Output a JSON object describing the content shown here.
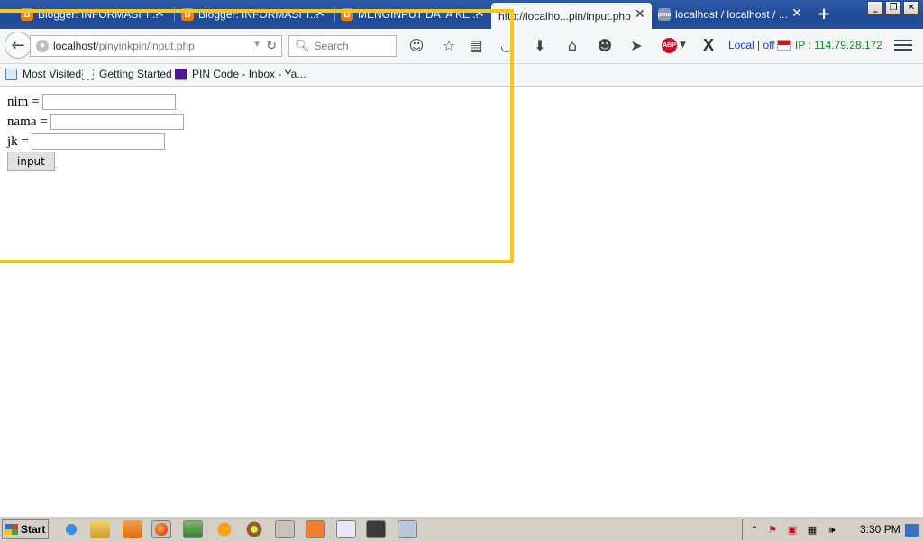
{
  "tabs": [
    {
      "label": "Blogger: INFORMASI T...",
      "favicon": "B",
      "active": false
    },
    {
      "label": "Blogger: INFORMASI T...",
      "favicon": "B",
      "active": false
    },
    {
      "label": "MENGINPUT DATA KE ...",
      "favicon": "B",
      "active": false
    },
    {
      "label": "http://localho...pin/input.php",
      "favicon": "",
      "active": true
    },
    {
      "label": "localhost / localhost / ...",
      "favicon": "pma",
      "active": false
    }
  ],
  "navbar": {
    "url_host": "localhost",
    "url_path": "/pinyinkpin/input.php",
    "search_placeholder": "Search",
    "local_status": "Local | off",
    "ip_text": "IP : 114.79.28.172"
  },
  "bookmarks": [
    {
      "label": "Most Visited"
    },
    {
      "label": "Getting Started"
    },
    {
      "label": "PIN Code - Inbox - Ya..."
    }
  ],
  "form": {
    "nim_label": "nim =",
    "nama_label": "nama =",
    "jk_label": "jk =",
    "submit_label": "input"
  },
  "taskbar": {
    "start_label": "Start",
    "clock": "3:30 PM"
  },
  "colors": {
    "highlight": "#f5c816",
    "tabstrip": "#1f4a96",
    "ip_text": "#0a8a1e",
    "local_text": "#1a3fd6"
  }
}
